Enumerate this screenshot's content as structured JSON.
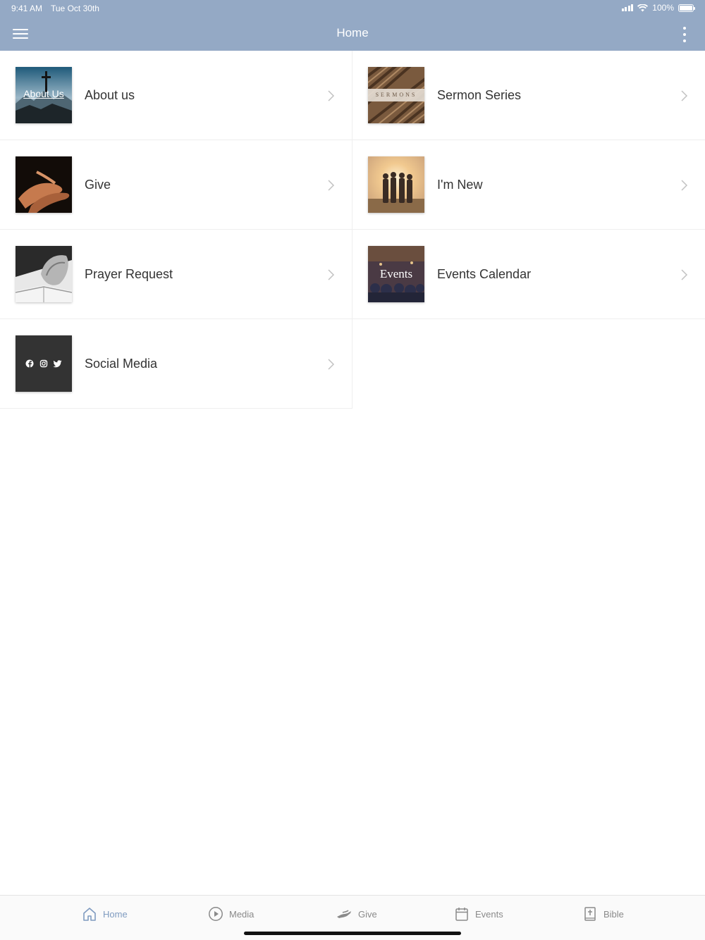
{
  "status_bar": {
    "time": "9:41 AM",
    "date": "Tue Oct 30th",
    "battery": "100%",
    "battery_level": 1.0
  },
  "header": {
    "title": "Home",
    "menu_icon": "hamburger-menu-icon",
    "more_icon": "vertical-ellipsis-icon",
    "color": "#94a9c5"
  },
  "tiles": [
    {
      "label": "About us",
      "thumb_text": "About Us"
    },
    {
      "label": "Sermon Series",
      "thumb_text": "SERMONS"
    },
    {
      "label": "Give"
    },
    {
      "label": "I'm New"
    },
    {
      "label": "Prayer Request"
    },
    {
      "label": "Events Calendar",
      "thumb_text": "Events"
    },
    {
      "label": "Social Media",
      "icons": [
        "facebook-icon",
        "instagram-icon",
        "twitter-icon"
      ]
    }
  ],
  "tabs": [
    {
      "label": "Home",
      "icon": "home-icon",
      "active": true
    },
    {
      "label": "Media",
      "icon": "play-circle-icon",
      "active": false
    },
    {
      "label": "Give",
      "icon": "give-hand-icon",
      "active": false
    },
    {
      "label": "Events",
      "icon": "calendar-icon",
      "active": false
    },
    {
      "label": "Bible",
      "icon": "bible-icon",
      "active": false
    }
  ],
  "colors": {
    "accent": "#7f9bc0",
    "inactive": "#8a8a8a"
  }
}
